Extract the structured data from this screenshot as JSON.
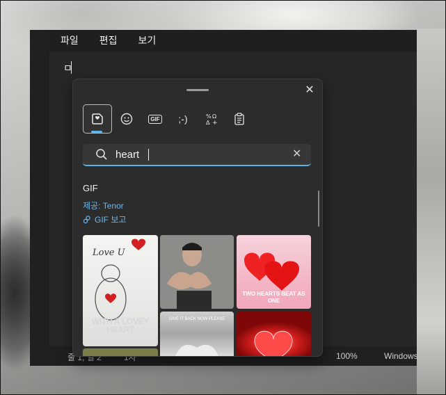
{
  "menu": {
    "file": "파일",
    "edit": "편집",
    "view": "보기"
  },
  "editor": {
    "text": "ㅁ"
  },
  "status": {
    "position": "줄 1, 열 2",
    "chars": "1자",
    "zoom": "100%",
    "encoding": "Windows"
  },
  "picker": {
    "close_label": "✕",
    "tabs": [
      {
        "name": "tab-stickers",
        "icon": "heart-sticker-icon",
        "active": true
      },
      {
        "name": "tab-emoji",
        "icon": "smiley-icon"
      },
      {
        "name": "tab-gif",
        "label": "GIF"
      },
      {
        "name": "tab-kaomoji",
        "label": ";-)"
      },
      {
        "name": "tab-symbols",
        "icon": "symbols-icon"
      },
      {
        "name": "tab-clipboard",
        "icon": "clipboard-icon"
      }
    ],
    "search": {
      "value": "heart",
      "clear_label": "✕"
    },
    "section_title": "GIF",
    "provider": "제공: Tenor",
    "view_gif": "GIF 보고",
    "gifs": [
      {
        "name": "gif-winnie-pooh",
        "caption": "WITH A LOVEY HEART",
        "top_text": "Love U"
      },
      {
        "name": "gif-heart-hands-man"
      },
      {
        "name": "gif-two-hearts",
        "caption": "TWO HEARTS BEAT AS ONE"
      },
      {
        "name": "gif-hands-heart",
        "caption": "GIVE IT BACK NOW PLEASE"
      },
      {
        "name": "gif-red-heart"
      }
    ]
  },
  "colors": {
    "accent": "#5fb2e6",
    "link": "#6cb8ef",
    "surface": "#2c2c2c"
  }
}
